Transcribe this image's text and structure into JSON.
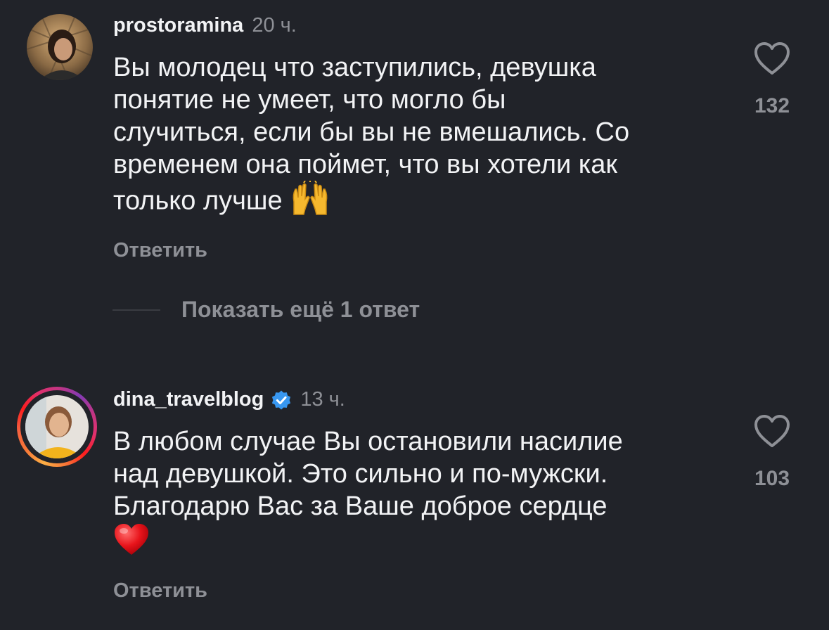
{
  "comments": [
    {
      "username": "prostoramina",
      "time": "20 ч.",
      "text": "Вы молодец что заступились, девушка\nпонятие не умеет, что могло бы\nслучиться, если бы вы не вмешались. Со\nвременем она поймет, что вы хотели как\nтолько лучше",
      "emoji": "raising-hands",
      "reply_label": "Ответить",
      "likes": "132",
      "verified": false,
      "story_ring": false
    },
    {
      "username": "dina_travelblog",
      "time": "13 ч.",
      "text": "В любом случае Вы остановили насилие\nнад девушкой.  Это сильно и по-мужски.\nБлагодарю Вас за Ваше доброе сердце",
      "emoji": "red-heart",
      "reply_label": "Ответить",
      "likes": "103",
      "verified": true,
      "story_ring": true
    }
  ],
  "more_replies_label": "Показать ещё 1 ответ",
  "colors": {
    "background": "#212329",
    "primary_text": "#f2f3f5",
    "secondary_text": "#8e9096",
    "verified_blue": "#3897f0"
  }
}
